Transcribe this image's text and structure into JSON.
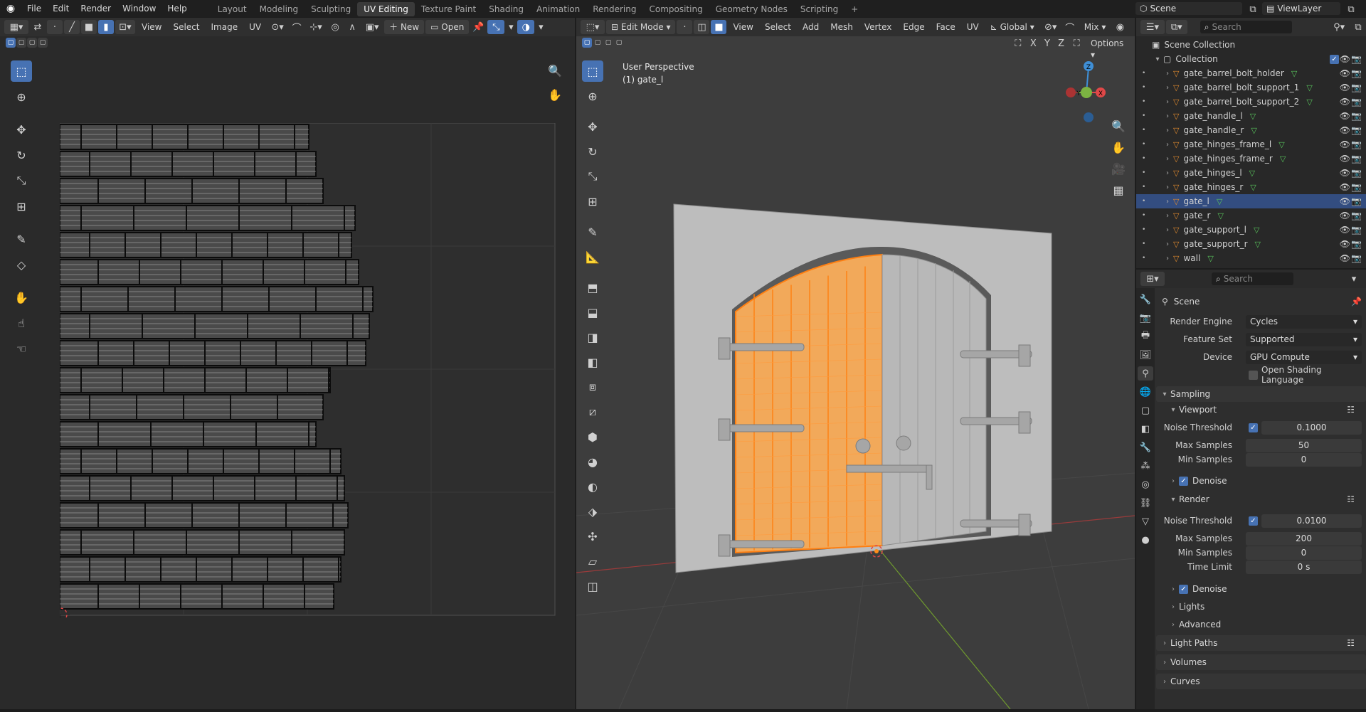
{
  "topbar": {
    "menus": [
      "File",
      "Edit",
      "Render",
      "Window",
      "Help"
    ],
    "workspaces": [
      "Layout",
      "Modeling",
      "Sculpting",
      "UV Editing",
      "Texture Paint",
      "Shading",
      "Animation",
      "Rendering",
      "Compositing",
      "Geometry Nodes",
      "Scripting"
    ],
    "active_workspace": "UV Editing",
    "plus": "+",
    "scene": "Scene",
    "viewlayer": "ViewLayer"
  },
  "uv_editor": {
    "menus": [
      "View",
      "Select",
      "Image",
      "UV"
    ],
    "new_label": "New",
    "open_label": "Open"
  },
  "viewport": {
    "mode": "Edit Mode",
    "menus": [
      "View",
      "Select",
      "Add",
      "Mesh",
      "Vertex",
      "Edge",
      "Face",
      "UV"
    ],
    "orientation": "Global",
    "shading": "Mix",
    "axes": [
      "X",
      "Y",
      "Z"
    ],
    "options_label": "Options",
    "overlay_title": "User Perspective",
    "overlay_object": "(1) gate_l",
    "gizmo": {
      "z": "Z",
      "y": "Y",
      "x": "X"
    }
  },
  "outliner": {
    "search_placeholder": "Search",
    "scene_collection": "Scene Collection",
    "collection": "Collection",
    "items": [
      "gate_barrel_bolt_holder",
      "gate_barrel_bolt_support_1",
      "gate_barrel_bolt_support_2",
      "gate_handle_l",
      "gate_handle_r",
      "gate_hinges_frame_l",
      "gate_hinges_frame_r",
      "gate_hinges_l",
      "gate_hinges_r",
      "gate_l",
      "gate_r",
      "gate_support_l",
      "gate_support_r",
      "wall"
    ],
    "selected": "gate_l"
  },
  "properties": {
    "search_placeholder": "Search",
    "context": "Scene",
    "render_engine_label": "Render Engine",
    "render_engine": "Cycles",
    "feature_set_label": "Feature Set",
    "feature_set": "Supported",
    "device_label": "Device",
    "device": "GPU Compute",
    "osl_label": "Open Shading Language",
    "sampling": "Sampling",
    "viewport": "Viewport",
    "noise_threshold_label": "Noise Threshold",
    "vp_noise": "0.1000",
    "max_samples_label": "Max Samples",
    "vp_max": "50",
    "min_samples_label": "Min Samples",
    "vp_min": "0",
    "denoise": "Denoise",
    "render": "Render",
    "r_noise": "0.0100",
    "r_max": "200",
    "r_min": "0",
    "time_limit_label": "Time Limit",
    "time_limit": "0 s",
    "lights": "Lights",
    "advanced": "Advanced",
    "light_paths": "Light Paths",
    "volumes": "Volumes",
    "curves": "Curves"
  },
  "colors": {
    "accent": "#4772b3",
    "selection": "#ff8c1a",
    "x_axis": "#e04848",
    "y_axis": "#7cb342",
    "z_axis": "#3f8fd6"
  }
}
